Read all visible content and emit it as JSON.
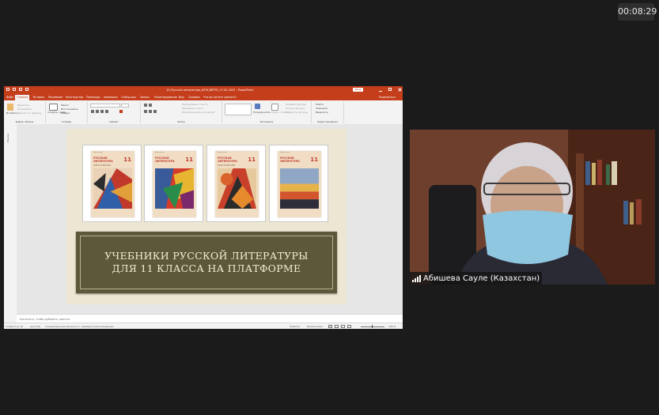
{
  "meeting": {
    "elapsed_time": "00:08:29"
  },
  "ppt": {
    "title": "10_Русская литература_ИГФ_ВЕРТЕ_17.02.2022  -  PowerPoint",
    "sign_in_label": "Вход",
    "tabs": [
      "Файл",
      "Главная",
      "Вставка",
      "Рисование",
      "Конструктор",
      "Переходы",
      "Анимация",
      "Слайд-шоу",
      "Запись",
      "Рецензирование",
      "Вид",
      "Справка"
    ],
    "active_tab_index": 1,
    "tell_me": "Что вы хотите сделать?",
    "share": "Поделиться",
    "ribbon": {
      "clipboard_group": "Буфер обмена",
      "paste": "Вставить",
      "cut": "Вырезать",
      "copy": "Копировать",
      "format_painter": "Формат по образцу",
      "slides_group": "Слайды",
      "new_slide": "Создать слайд",
      "layout": "Макет",
      "reset": "Восстановить",
      "section": "Раздел",
      "font_group": "Шрифт",
      "paragraph_group": "Абзац",
      "text_direction": "Направление текста",
      "align_text": "Выровнять текст",
      "convert_smartart": "Преобразовать в SmartArt",
      "drawing_group": "Рисование",
      "arrange": "Упорядочить",
      "quick_styles": "Экспресс-стили",
      "shape_fill": "Заливка фигуры",
      "shape_outline": "Контур фигуры",
      "shape_effects": "Эффекты фигуры",
      "editing_group": "Редактирование",
      "find": "Найти",
      "replace": "Заменить",
      "select": "Выделить"
    },
    "thumbnails_label": "Эскизы",
    "slide": {
      "book_series": "Издательство",
      "book_title_line1": "РУССКАЯ",
      "book_title_line2": "ЛИТЕРАТУРА",
      "book_number": "11",
      "book_subtitle": "ХРЕСТОМАТИЯ",
      "banner_line1": "УЧЕБНИКИ РУССКОЙ ЛИТЕРАТУРЫ",
      "banner_line2": "ДЛЯ 11 КЛАССА НА ПЛАТФОРМЕ"
    },
    "notes_placeholder": "Щелкните, чтобы добавить заметки",
    "status": {
      "slide_counter": "Слайд 6 из 16",
      "language": "русский",
      "accessibility": "Специальные возможности: проверьте рекомендации",
      "notes_btn": "Заметки",
      "comments_btn": "Примечания",
      "zoom": "106 %"
    }
  },
  "video": {
    "participant_name": "Абишева Сауле (Казахстан)"
  },
  "colors": {
    "ppt_accent": "#c43e1c",
    "banner_bg": "#5c5839",
    "slide_bg": "#ece6d2"
  }
}
